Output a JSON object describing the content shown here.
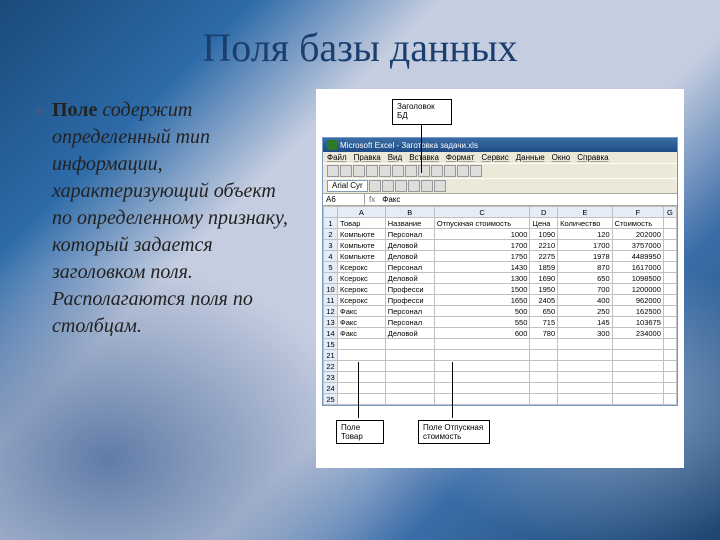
{
  "title": "Поля базы данных",
  "body": {
    "bold": "Поле",
    "rest": " содержит определенный тип информации, характеризующий объект по определенному признаку, который задается заголовком поля. Располагаются поля  по столбцам."
  },
  "annotations": {
    "top": "Заголовок БД",
    "bottom1": "Поле Товар",
    "bottom2": "Поле Отпускная стоимость"
  },
  "excel": {
    "title": "Microsoft Excel - Заготовка задачи.xls",
    "menu": [
      "Файл",
      "Правка",
      "Вид",
      "Вставка",
      "Формат",
      "Сервис",
      "Данные",
      "Окно",
      "Справка"
    ],
    "font": "Arial Cyr",
    "cellref": "A6",
    "cellval": "Факс",
    "chart_data": {
      "type": "table",
      "colLetters": [
        "A",
        "B",
        "C",
        "D",
        "E",
        "F",
        "G"
      ],
      "headers": [
        "Товар",
        "Название",
        "Отпускная стоимость",
        "Цена",
        "Количество",
        "Стоимость",
        ""
      ],
      "rowNums": [
        1,
        2,
        3,
        4,
        5,
        6,
        10,
        11,
        12,
        13,
        14,
        15,
        21,
        22,
        23,
        24,
        25
      ],
      "rows": [
        [
          "Компьюте",
          "Персонал",
          "1000",
          "1090",
          "120",
          "202000",
          ""
        ],
        [
          "Компьюте",
          "Деловой",
          "1700",
          "2210",
          "1700",
          "3757000",
          ""
        ],
        [
          "Компьюте",
          "Деловой",
          "1750",
          "2275",
          "1978",
          "4489950",
          ""
        ],
        [
          "Ксерокс",
          "Персонал",
          "1430",
          "1859",
          "870",
          "1617000",
          ""
        ],
        [
          "Ксерокс",
          "Деловой",
          "1300",
          "1690",
          "650",
          "1098500",
          ""
        ],
        [
          "Ксерокс",
          "Професси",
          "1500",
          "1950",
          "700",
          "1200000",
          ""
        ],
        [
          "Ксерокс",
          "Професси",
          "1650",
          "2405",
          "400",
          "962000",
          ""
        ],
        [
          "Факс",
          "Персонал",
          "500",
          "650",
          "250",
          "162500",
          ""
        ],
        [
          "Факс",
          "Персонал",
          "550",
          "715",
          "145",
          "103675",
          ""
        ],
        [
          "Факс",
          "Деловой",
          "600",
          "780",
          "300",
          "234000",
          ""
        ]
      ]
    }
  }
}
